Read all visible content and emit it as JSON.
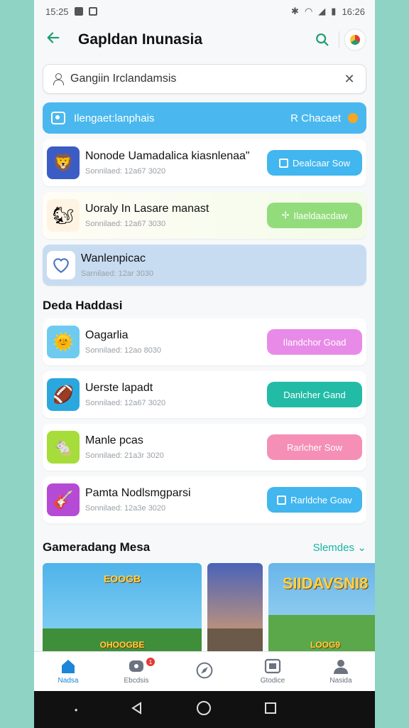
{
  "status_bar": {
    "time_left": "15:25",
    "time_right": "16:26"
  },
  "app_bar": {
    "title": "Gapldan Inunasia"
  },
  "search": {
    "value": "Gangiin Irclandamsis"
  },
  "banner": {
    "text": "Ilengaet:lanphais",
    "right_text": "R Chacaet"
  },
  "featured": [
    {
      "name": "Nonode Uamadalica kiasnlenaa\"",
      "meta": "Sonnilaed: 12a67 3020",
      "button": "Dealcaar Sow",
      "button_color": "#41b6ef",
      "thumb": "🦁",
      "thumb_bg": "#3b5cc4",
      "tint": ""
    },
    {
      "name": "Uoraly In Lasare manast",
      "meta": "Sonnilaed: 12a67 3030",
      "button": "Ilaeldaacdaw",
      "button_color": "#93dc7c",
      "thumb": "🐿",
      "thumb_bg": "#fff4e3",
      "tint": "tint-green"
    }
  ],
  "wishlist": {
    "name": "Wanlenpicac",
    "meta": "Sarnilaed: 12ar 3030"
  },
  "section_games": {
    "title": "Deda Haddasi"
  },
  "games": [
    {
      "name": "Oagarlia",
      "meta": "Sonnilaed: 12ao 8030",
      "button": "Ilandchor Goad",
      "button_color": "#e88be8",
      "thumb": "🌞",
      "thumb_bg": "#6ecbef"
    },
    {
      "name": "Uerste lapadt",
      "meta": "Sonnilaed: 12a67 3020",
      "button": "Danlcher Gand",
      "button_color": "#22bba6",
      "thumb": "🏈",
      "thumb_bg": "#2aa8de"
    },
    {
      "name": "Manle pcas",
      "meta": "Sonnilaed: 21a3r 3020",
      "button": "Rarlcher Sow",
      "button_color": "#f58fb5",
      "thumb": "🐁",
      "thumb_bg": "#a6dd3a"
    },
    {
      "name": "Pamta Nodlsmgparsi",
      "meta": "Sonnilaed: 12a3e 3020",
      "button": "Rarldche Goav",
      "button_color": "#41b6ef",
      "thumb": "🎸",
      "thumb_bg": "#b54ad4"
    }
  ],
  "more_section": {
    "title": "Gameradang Mesa",
    "link": "Slemdes"
  },
  "carousel": [
    {
      "title": "EOOGB",
      "subtitle": "OHOOGBE",
      "sky": "#4fb3ea",
      "ground": "#3f8f3a"
    },
    {
      "title": "",
      "subtitle": "",
      "sky": "#4a63b8",
      "ground": "#6b5a49"
    },
    {
      "title": "SIIDAVSNI8",
      "subtitle": "LOOG9",
      "sky": "#69b5e8",
      "ground": "#5aa84a"
    }
  ],
  "bottom_nav": [
    {
      "label": "Nadsa",
      "icon": "home-icon",
      "active": true
    },
    {
      "label": "Ebcdsis",
      "icon": "gamepad-icon",
      "active": false,
      "badge": "1"
    },
    {
      "label": "",
      "icon": "compass-icon",
      "active": false
    },
    {
      "label": "Gtodice",
      "icon": "library-icon",
      "active": false
    },
    {
      "label": "Nasida",
      "icon": "profile-icon",
      "active": false
    }
  ],
  "colors": {
    "accent_green": "#1e9e6e",
    "banner_blue": "#4ab8ef",
    "link_teal": "#17b3a3",
    "nav_active": "#1c86d8"
  }
}
